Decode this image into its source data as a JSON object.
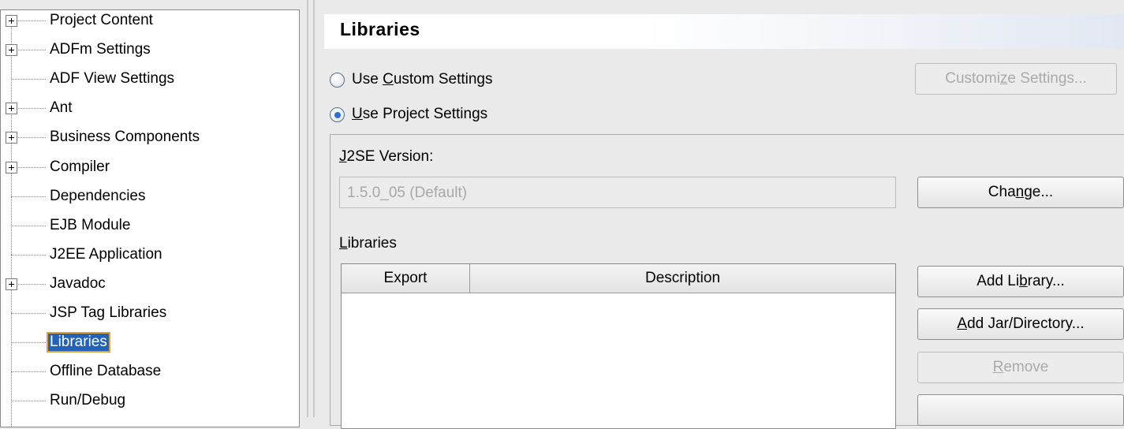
{
  "tree": {
    "items": [
      {
        "label": "Project Content",
        "expandable": true
      },
      {
        "label": "ADFm Settings",
        "expandable": true
      },
      {
        "label": "ADF View Settings",
        "expandable": false
      },
      {
        "label": "Ant",
        "expandable": true
      },
      {
        "label": "Business Components",
        "expandable": true
      },
      {
        "label": "Compiler",
        "expandable": true
      },
      {
        "label": "Dependencies",
        "expandable": false
      },
      {
        "label": "EJB Module",
        "expandable": false
      },
      {
        "label": "J2EE Application",
        "expandable": false
      },
      {
        "label": "Javadoc",
        "expandable": true
      },
      {
        "label": "JSP Tag Libraries",
        "expandable": false
      },
      {
        "label": "Libraries",
        "expandable": false,
        "selected": true
      },
      {
        "label": "Offline Database",
        "expandable": false
      },
      {
        "label": "Run/Debug",
        "expandable": false
      }
    ]
  },
  "panel": {
    "title": "Libraries",
    "custom_settings": {
      "pre": "Use ",
      "mnemonic": "C",
      "post": "ustom Settings",
      "checked": false
    },
    "project_settings": {
      "pre": "",
      "mnemonic": "U",
      "post": "se Project Settings",
      "checked": true
    },
    "customize_button": {
      "pre": "Customi",
      "mnemonic": "z",
      "post": "e Settings..."
    },
    "j2se_label": {
      "pre": "",
      "mnemonic": "J",
      "post": "2SE Version:"
    },
    "j2se_value": "1.5.0_05 (Default)",
    "change_button": {
      "pre": "Cha",
      "mnemonic": "n",
      "post": "ge..."
    },
    "libraries_label": {
      "pre": "",
      "mnemonic": "L",
      "post": "ibraries"
    },
    "table_headers": {
      "export": "Export",
      "description": "Description"
    },
    "add_library_button": {
      "pre": "Add Li",
      "mnemonic": "b",
      "post": "rary..."
    },
    "add_jar_button": {
      "pre": "",
      "mnemonic": "A",
      "post": "dd Jar/Directory..."
    },
    "remove_button": {
      "pre": "",
      "mnemonic": "R",
      "post": "emove"
    }
  },
  "colors": {
    "selection": "#2462b5",
    "selection_outline": "#e0a13b",
    "radio_dot": "#2e6fd0"
  }
}
